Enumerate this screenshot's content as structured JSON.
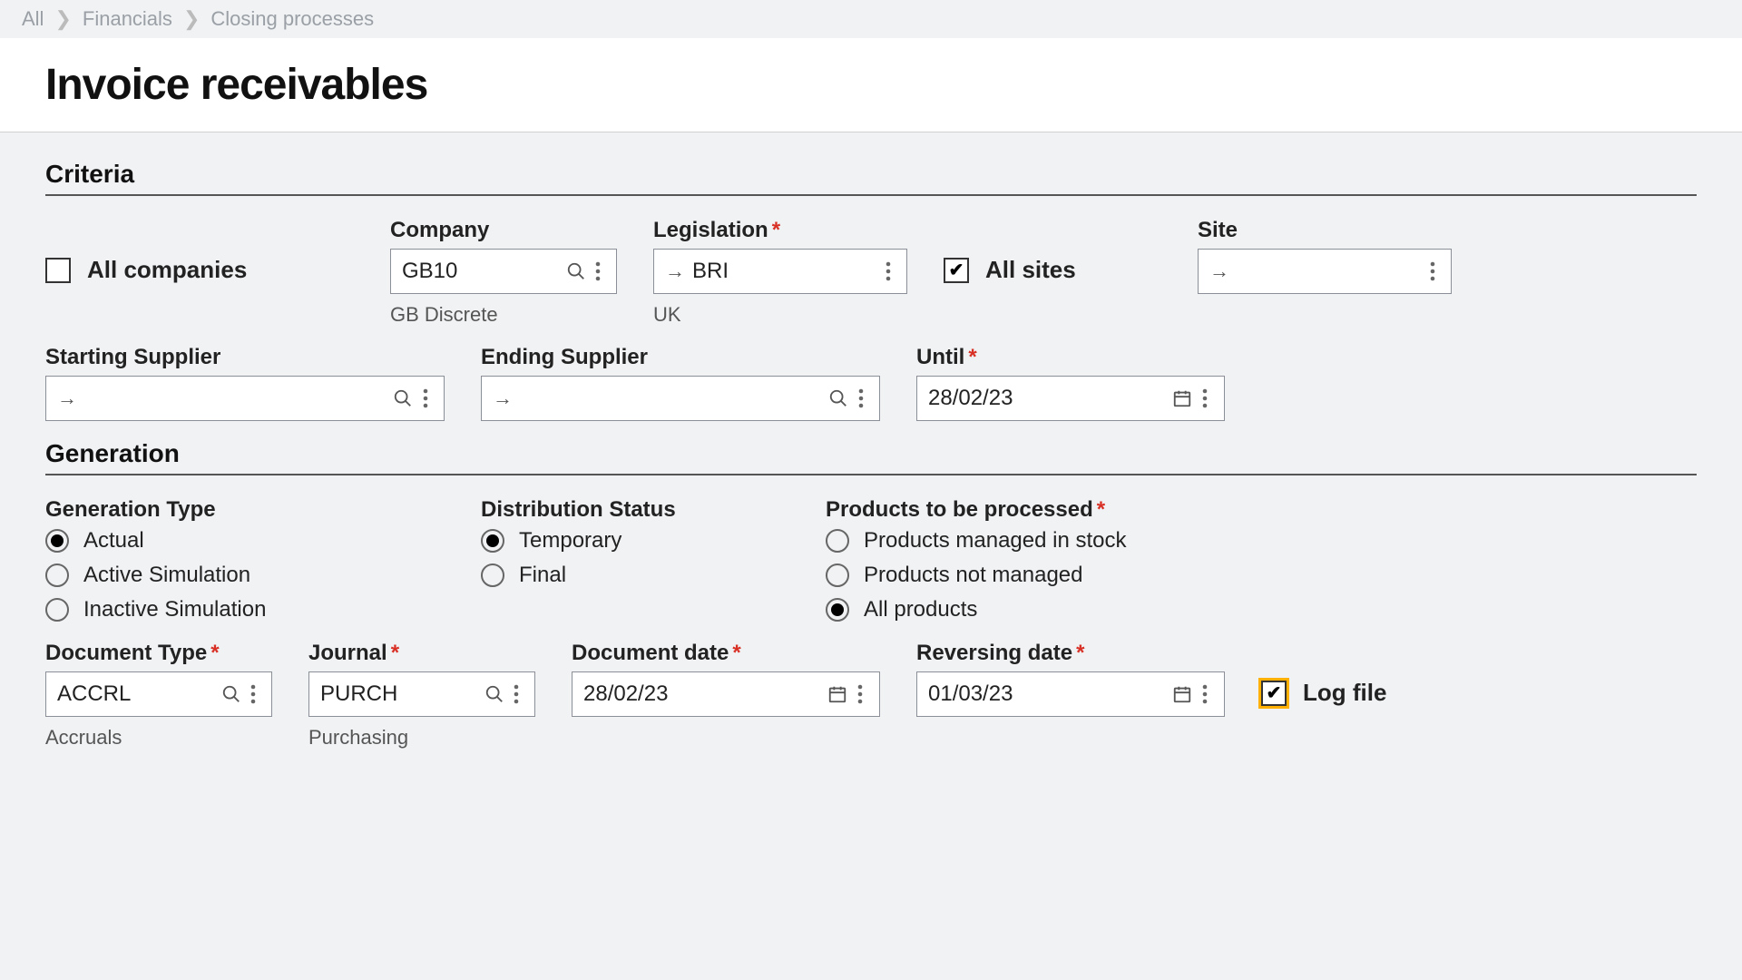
{
  "breadcrumb": {
    "items": [
      "All",
      "Financials",
      "Closing processes"
    ]
  },
  "header": {
    "title": "Invoice receivables"
  },
  "criteria": {
    "title": "Criteria",
    "allCompanies": {
      "label": "All companies",
      "checked": false
    },
    "company": {
      "label": "Company",
      "value": "GB10",
      "hint": "GB Discrete"
    },
    "legislation": {
      "label": "Legislation",
      "value": "BRI",
      "hint": "UK",
      "required": true
    },
    "allSites": {
      "label": "All sites",
      "checked": true
    },
    "site": {
      "label": "Site",
      "value": ""
    },
    "startSupplier": {
      "label": "Starting Supplier",
      "value": ""
    },
    "endSupplier": {
      "label": "Ending Supplier",
      "value": ""
    },
    "until": {
      "label": "Until",
      "value": "28/02/23",
      "required": true
    }
  },
  "generation": {
    "title": "Generation",
    "genType": {
      "label": "Generation Type",
      "options": [
        "Actual",
        "Active Simulation",
        "Inactive Simulation"
      ],
      "selected": 0
    },
    "distStatus": {
      "label": "Distribution Status",
      "options": [
        "Temporary",
        "Final"
      ],
      "selected": 0
    },
    "products": {
      "label": "Products to be processed",
      "required": true,
      "options": [
        "Products managed in stock",
        "Products not managed",
        "All products"
      ],
      "selected": 2
    },
    "docType": {
      "label": "Document Type",
      "value": "ACCRL",
      "hint": "Accruals",
      "required": true
    },
    "journal": {
      "label": "Journal",
      "value": "PURCH",
      "hint": "Purchasing",
      "required": true
    },
    "docDate": {
      "label": "Document date",
      "value": "28/02/23",
      "required": true
    },
    "revDate": {
      "label": "Reversing date",
      "value": "01/03/23",
      "required": true
    },
    "logFile": {
      "label": "Log file",
      "checked": true
    }
  }
}
